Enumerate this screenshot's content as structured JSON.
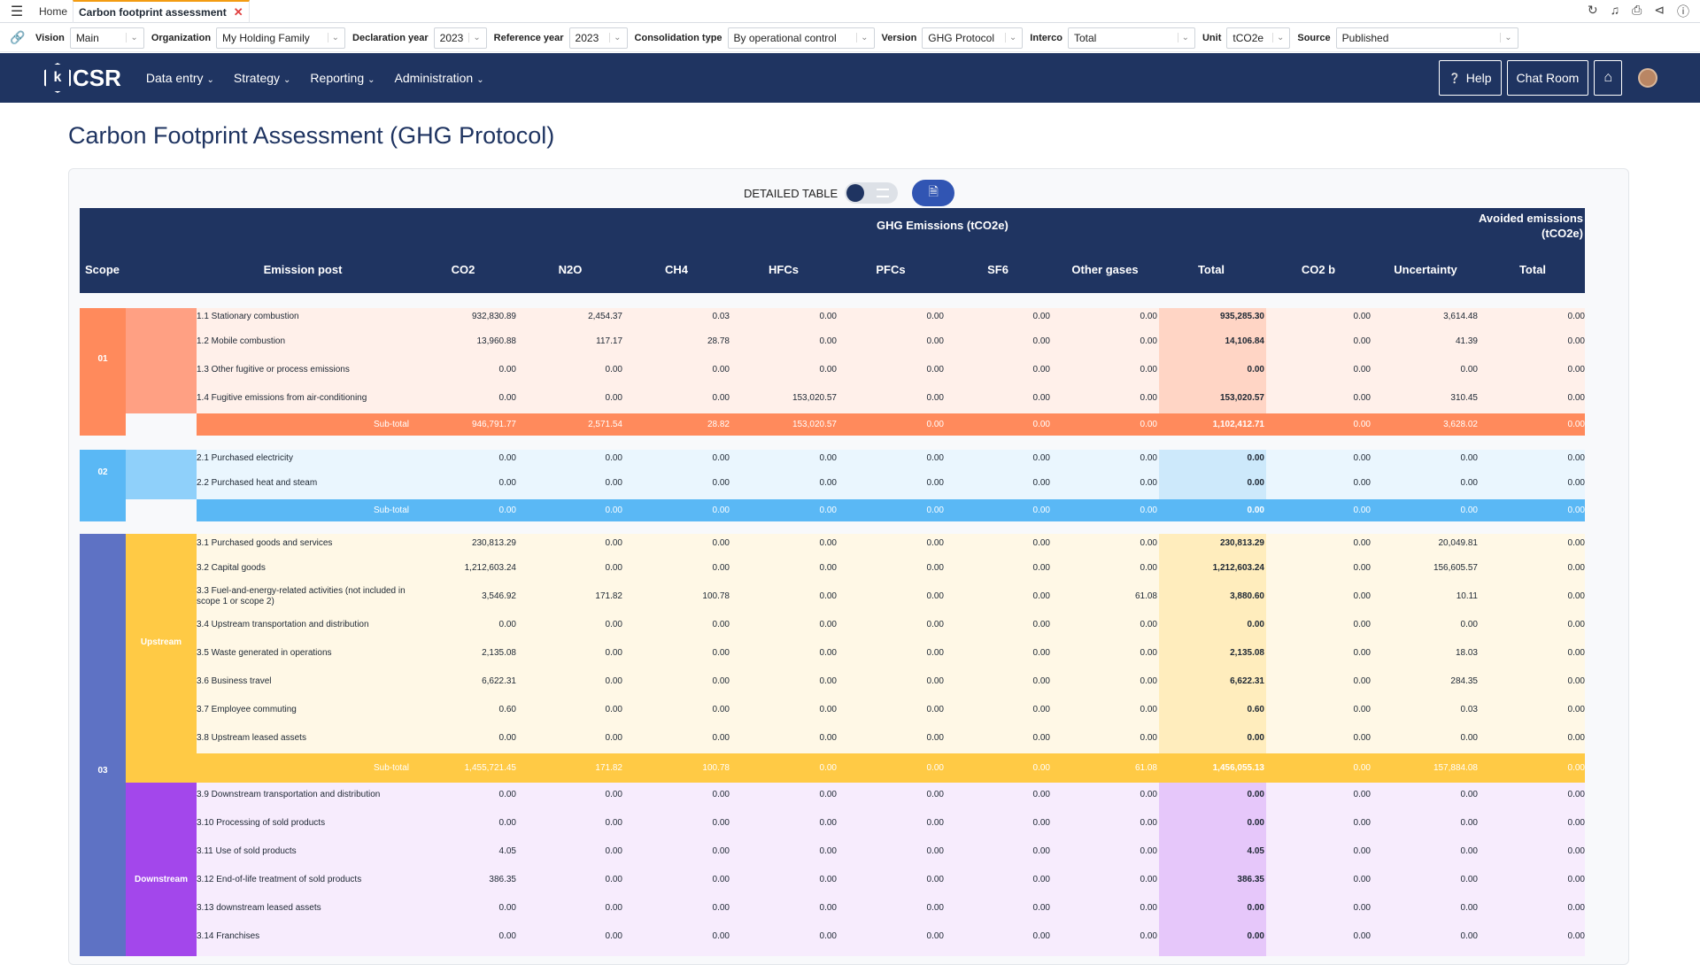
{
  "tabbar": {
    "home": "Home",
    "active_tab": "Carbon footprint assessment"
  },
  "filters": [
    {
      "label": "Vision",
      "value": "Main",
      "w": 84
    },
    {
      "label": "Organization",
      "value": "My Holding Family",
      "w": 146
    },
    {
      "label": "Declaration year",
      "value": "2023",
      "w": 60
    },
    {
      "label": "Reference year",
      "value": "2023",
      "w": 66
    },
    {
      "label": "Consolidation type",
      "value": "By operational control",
      "w": 166
    },
    {
      "label": "Version",
      "value": "GHG Protocol",
      "w": 114
    },
    {
      "label": "Interco",
      "value": "Total",
      "w": 144
    },
    {
      "label": "Unit",
      "value": "tCO2e",
      "w": 72
    },
    {
      "label": "Source",
      "value": "Published",
      "w": 206
    }
  ],
  "nav": {
    "brand": "CSR",
    "menu": [
      "Data entry",
      "Strategy",
      "Reporting",
      "Administration"
    ],
    "help": "Help",
    "chat": "Chat Room"
  },
  "page_title": "Carbon Footprint Assessment (GHG Protocol)",
  "toolbar": {
    "detailed_table": "DETAILED TABLE"
  },
  "table": {
    "group_ghg": "GHG Emissions (tCO2e)",
    "group_avoided": "Avoided emissions (tCO2e)",
    "headers": [
      "Scope",
      "Emission post",
      "CO2",
      "N2O",
      "CH4",
      "HFCs",
      "PFCs",
      "SF6",
      "Other gases",
      "Total",
      "CO2 b",
      "Uncertainty",
      "Total"
    ],
    "subtotal_label": "Sub-total",
    "scope1": {
      "label": "01",
      "rows": [
        {
          "post": "1.1 Stationary combustion",
          "v": [
            "932,830.89",
            "2,454.37",
            "0.03",
            "0.00",
            "0.00",
            "0.00",
            "0.00",
            "935,285.30",
            "0.00",
            "3,614.48",
            "0.00"
          ]
        },
        {
          "post": "1.2 Mobile combustion",
          "v": [
            "13,960.88",
            "117.17",
            "28.78",
            "0.00",
            "0.00",
            "0.00",
            "0.00",
            "14,106.84",
            "0.00",
            "41.39",
            "0.00"
          ]
        },
        {
          "post": "1.3 Other fugitive or process emissions",
          "v": [
            "0.00",
            "0.00",
            "0.00",
            "0.00",
            "0.00",
            "0.00",
            "0.00",
            "0.00",
            "0.00",
            "0.00",
            "0.00"
          ]
        },
        {
          "post": "1.4 Fugitive emissions from air-conditioning",
          "v": [
            "0.00",
            "0.00",
            "0.00",
            "153,020.57",
            "0.00",
            "0.00",
            "0.00",
            "153,020.57",
            "0.00",
            "310.45",
            "0.00"
          ]
        }
      ],
      "subtotal": [
        "946,791.77",
        "2,571.54",
        "28.82",
        "153,020.57",
        "0.00",
        "0.00",
        "0.00",
        "1,102,412.71",
        "0.00",
        "3,628.02",
        "0.00"
      ]
    },
    "scope2": {
      "label": "02",
      "rows": [
        {
          "post": "2.1 Purchased electricity",
          "v": [
            "0.00",
            "0.00",
            "0.00",
            "0.00",
            "0.00",
            "0.00",
            "0.00",
            "0.00",
            "0.00",
            "0.00",
            "0.00"
          ]
        },
        {
          "post": "2.2 Purchased heat and steam",
          "v": [
            "0.00",
            "0.00",
            "0.00",
            "0.00",
            "0.00",
            "0.00",
            "0.00",
            "0.00",
            "0.00",
            "0.00",
            "0.00"
          ]
        }
      ],
      "subtotal": [
        "0.00",
        "0.00",
        "0.00",
        "0.00",
        "0.00",
        "0.00",
        "0.00",
        "0.00",
        "0.00",
        "0.00",
        "0.00"
      ]
    },
    "scope3": {
      "label": "03",
      "upstream_label": "Upstream",
      "downstream_label": "Downstream",
      "upstream_rows": [
        {
          "post": "3.1 Purchased goods and services",
          "v": [
            "230,813.29",
            "0.00",
            "0.00",
            "0.00",
            "0.00",
            "0.00",
            "0.00",
            "230,813.29",
            "0.00",
            "20,049.81",
            "0.00"
          ]
        },
        {
          "post": "3.2 Capital goods",
          "v": [
            "1,212,603.24",
            "0.00",
            "0.00",
            "0.00",
            "0.00",
            "0.00",
            "0.00",
            "1,212,603.24",
            "0.00",
            "156,605.57",
            "0.00"
          ]
        },
        {
          "post": "3.3 Fuel-and-energy-related activities (not included in scope 1 or scope 2)",
          "v": [
            "3,546.92",
            "171.82",
            "100.78",
            "0.00",
            "0.00",
            "0.00",
            "61.08",
            "3,880.60",
            "0.00",
            "10.11",
            "0.00"
          ]
        },
        {
          "post": "3.4 Upstream transportation and distribution",
          "v": [
            "0.00",
            "0.00",
            "0.00",
            "0.00",
            "0.00",
            "0.00",
            "0.00",
            "0.00",
            "0.00",
            "0.00",
            "0.00"
          ]
        },
        {
          "post": "3.5 Waste generated in operations",
          "v": [
            "2,135.08",
            "0.00",
            "0.00",
            "0.00",
            "0.00",
            "0.00",
            "0.00",
            "2,135.08",
            "0.00",
            "18.03",
            "0.00"
          ]
        },
        {
          "post": "3.6 Business travel",
          "v": [
            "6,622.31",
            "0.00",
            "0.00",
            "0.00",
            "0.00",
            "0.00",
            "0.00",
            "6,622.31",
            "0.00",
            "284.35",
            "0.00"
          ]
        },
        {
          "post": "3.7 Employee commuting",
          "v": [
            "0.60",
            "0.00",
            "0.00",
            "0.00",
            "0.00",
            "0.00",
            "0.00",
            "0.60",
            "0.00",
            "0.03",
            "0.00"
          ]
        },
        {
          "post": "3.8 Upstream leased assets",
          "v": [
            "0.00",
            "0.00",
            "0.00",
            "0.00",
            "0.00",
            "0.00",
            "0.00",
            "0.00",
            "0.00",
            "0.00",
            "0.00"
          ]
        }
      ],
      "upstream_subtotal": [
        "1,455,721.45",
        "171.82",
        "100.78",
        "0.00",
        "0.00",
        "0.00",
        "61.08",
        "1,456,055.13",
        "0.00",
        "157,884.08",
        "0.00"
      ],
      "downstream_rows": [
        {
          "post": "3.9 Downstream transportation and distribution",
          "v": [
            "0.00",
            "0.00",
            "0.00",
            "0.00",
            "0.00",
            "0.00",
            "0.00",
            "0.00",
            "0.00",
            "0.00",
            "0.00"
          ]
        },
        {
          "post": "3.10 Processing of sold products",
          "v": [
            "0.00",
            "0.00",
            "0.00",
            "0.00",
            "0.00",
            "0.00",
            "0.00",
            "0.00",
            "0.00",
            "0.00",
            "0.00"
          ]
        },
        {
          "post": "3.11 Use of sold products",
          "v": [
            "4.05",
            "0.00",
            "0.00",
            "0.00",
            "0.00",
            "0.00",
            "0.00",
            "4.05",
            "0.00",
            "0.00",
            "0.00"
          ]
        },
        {
          "post": "3.12 End-of-life treatment of sold products",
          "v": [
            "386.35",
            "0.00",
            "0.00",
            "0.00",
            "0.00",
            "0.00",
            "0.00",
            "386.35",
            "0.00",
            "0.00",
            "0.00"
          ]
        },
        {
          "post": "3.13 downstream leased assets",
          "v": [
            "0.00",
            "0.00",
            "0.00",
            "0.00",
            "0.00",
            "0.00",
            "0.00",
            "0.00",
            "0.00",
            "0.00",
            "0.00"
          ]
        },
        {
          "post": "3.14 Franchises",
          "v": [
            "0.00",
            "0.00",
            "0.00",
            "0.00",
            "0.00",
            "0.00",
            "0.00",
            "0.00",
            "0.00",
            "0.00",
            "0.00"
          ]
        }
      ]
    }
  },
  "colors": {
    "nav": "#1f3461",
    "scope1_dark": "#ff8a5c",
    "scope1_mid": "#ffa083",
    "scope1_bg": "#fff0ea",
    "scope1_total": "#ffd5c5",
    "scope2_dark": "#5ab8f5",
    "scope2_mid": "#8fd0fa",
    "scope2_bg": "#eaf6fe",
    "scope2_total": "#cde9fb",
    "scope3_dark": "#5e72c4",
    "up_dark": "#ffca45",
    "up_bg": "#fff8e6",
    "up_total": "#ffedbd",
    "down_dark": "#a347eb",
    "down_bg": "#f7ecfd",
    "down_total": "#e6c7fa"
  }
}
